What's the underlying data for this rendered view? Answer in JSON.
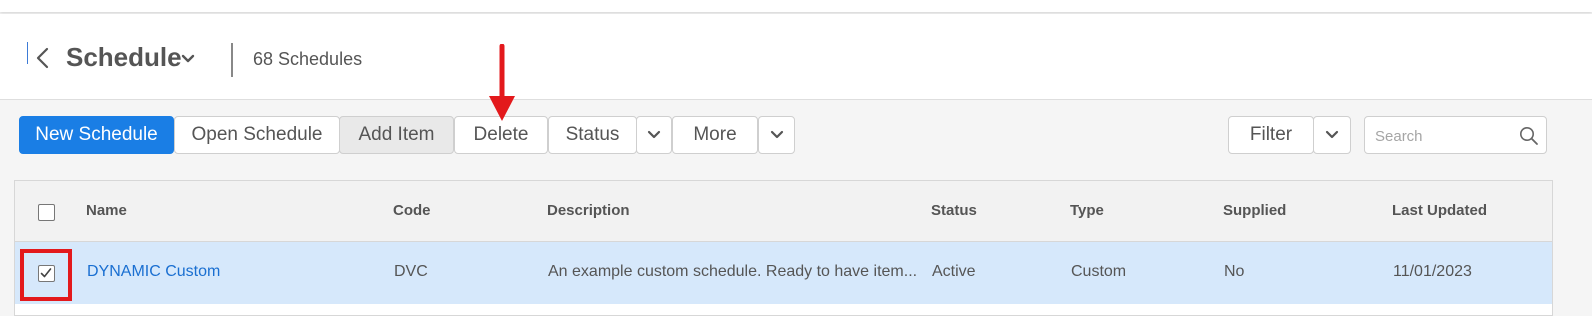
{
  "header": {
    "title": "Schedule",
    "count_text": "68 Schedules"
  },
  "toolbar": {
    "new_schedule": "New Schedule",
    "open_schedule": "Open Schedule",
    "add_item": "Add Item",
    "delete": "Delete",
    "status": "Status",
    "more": "More",
    "filter": "Filter",
    "search_placeholder": "Search"
  },
  "table": {
    "columns": [
      "Name",
      "Code",
      "Description",
      "Status",
      "Type",
      "Supplied",
      "Last Updated"
    ],
    "rows": [
      {
        "checked": true,
        "name": "DYNAMIC Custom",
        "code": "DVC",
        "description": "An example custom schedule. Ready to have item...",
        "status": "Active",
        "type": "Custom",
        "supplied": "No",
        "last_updated": "11/01/2023"
      }
    ]
  },
  "colors": {
    "primary": "#1a7ee5",
    "selected_row": "#d6e8fb",
    "link": "#1a6fd1",
    "annotation_red": "#e3191c"
  },
  "icons": {
    "back": "chevron-left-icon",
    "title_dropdown": "chevron-down-icon",
    "search": "search-icon",
    "annotation": "arrow-down-icon"
  }
}
